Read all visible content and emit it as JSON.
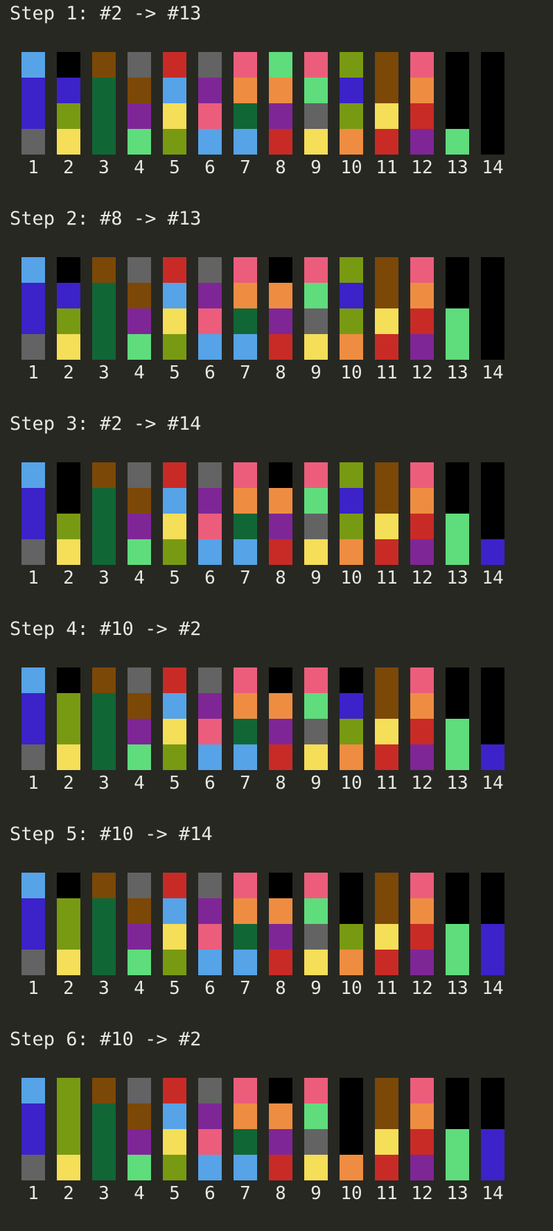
{
  "colors": {
    "background": "#272822",
    "text": "#e8e8e2",
    "empty": "#000000",
    "sky": "#56a3e8",
    "indigo": "#3c22c9",
    "gray": "#636363",
    "olive": "#789a12",
    "yellow": "#f5de58",
    "brown": "#7b4807",
    "dkgreen": "#116636",
    "purple": "#7f2697",
    "mint": "#5fdc7c",
    "red": "#c82b26",
    "pink": "#ec5d7c",
    "orange": "#ee8d41"
  },
  "steps": [
    {
      "title": "Step 1: #2 -> #13",
      "tubes": [
        {
          "label": "1",
          "balls": [
            "gray",
            "indigo",
            "indigo",
            "sky"
          ]
        },
        {
          "label": "2",
          "balls": [
            "yellow",
            "olive",
            "indigo"
          ]
        },
        {
          "label": "3",
          "balls": [
            "dkgreen",
            "dkgreen",
            "dkgreen",
            "brown"
          ]
        },
        {
          "label": "4",
          "balls": [
            "mint",
            "purple",
            "brown",
            "gray"
          ]
        },
        {
          "label": "5",
          "balls": [
            "olive",
            "yellow",
            "sky",
            "red"
          ]
        },
        {
          "label": "6",
          "balls": [
            "sky",
            "pink",
            "purple",
            "gray"
          ]
        },
        {
          "label": "7",
          "balls": [
            "sky",
            "dkgreen",
            "orange",
            "pink"
          ]
        },
        {
          "label": "8",
          "balls": [
            "red",
            "purple",
            "orange",
            "mint"
          ]
        },
        {
          "label": "9",
          "balls": [
            "yellow",
            "gray",
            "mint",
            "pink"
          ]
        },
        {
          "label": "10",
          "balls": [
            "orange",
            "olive",
            "indigo",
            "olive"
          ]
        },
        {
          "label": "11",
          "balls": [
            "red",
            "yellow",
            "brown",
            "brown"
          ]
        },
        {
          "label": "12",
          "balls": [
            "purple",
            "red",
            "orange",
            "pink"
          ]
        },
        {
          "label": "13",
          "balls": [
            "mint"
          ]
        },
        {
          "label": "14",
          "balls": []
        }
      ]
    },
    {
      "title": "Step 2: #8 -> #13",
      "tubes": [
        {
          "label": "1",
          "balls": [
            "gray",
            "indigo",
            "indigo",
            "sky"
          ]
        },
        {
          "label": "2",
          "balls": [
            "yellow",
            "olive",
            "indigo"
          ]
        },
        {
          "label": "3",
          "balls": [
            "dkgreen",
            "dkgreen",
            "dkgreen",
            "brown"
          ]
        },
        {
          "label": "4",
          "balls": [
            "mint",
            "purple",
            "brown",
            "gray"
          ]
        },
        {
          "label": "5",
          "balls": [
            "olive",
            "yellow",
            "sky",
            "red"
          ]
        },
        {
          "label": "6",
          "balls": [
            "sky",
            "pink",
            "purple",
            "gray"
          ]
        },
        {
          "label": "7",
          "balls": [
            "sky",
            "dkgreen",
            "orange",
            "pink"
          ]
        },
        {
          "label": "8",
          "balls": [
            "red",
            "purple",
            "orange"
          ]
        },
        {
          "label": "9",
          "balls": [
            "yellow",
            "gray",
            "mint",
            "pink"
          ]
        },
        {
          "label": "10",
          "balls": [
            "orange",
            "olive",
            "indigo",
            "olive"
          ]
        },
        {
          "label": "11",
          "balls": [
            "red",
            "yellow",
            "brown",
            "brown"
          ]
        },
        {
          "label": "12",
          "balls": [
            "purple",
            "red",
            "orange",
            "pink"
          ]
        },
        {
          "label": "13",
          "balls": [
            "mint",
            "mint"
          ]
        },
        {
          "label": "14",
          "balls": []
        }
      ]
    },
    {
      "title": "Step 3: #2 -> #14",
      "tubes": [
        {
          "label": "1",
          "balls": [
            "gray",
            "indigo",
            "indigo",
            "sky"
          ]
        },
        {
          "label": "2",
          "balls": [
            "yellow",
            "olive"
          ]
        },
        {
          "label": "3",
          "balls": [
            "dkgreen",
            "dkgreen",
            "dkgreen",
            "brown"
          ]
        },
        {
          "label": "4",
          "balls": [
            "mint",
            "purple",
            "brown",
            "gray"
          ]
        },
        {
          "label": "5",
          "balls": [
            "olive",
            "yellow",
            "sky",
            "red"
          ]
        },
        {
          "label": "6",
          "balls": [
            "sky",
            "pink",
            "purple",
            "gray"
          ]
        },
        {
          "label": "7",
          "balls": [
            "sky",
            "dkgreen",
            "orange",
            "pink"
          ]
        },
        {
          "label": "8",
          "balls": [
            "red",
            "purple",
            "orange"
          ]
        },
        {
          "label": "9",
          "balls": [
            "yellow",
            "gray",
            "mint",
            "pink"
          ]
        },
        {
          "label": "10",
          "balls": [
            "orange",
            "olive",
            "indigo",
            "olive"
          ]
        },
        {
          "label": "11",
          "balls": [
            "red",
            "yellow",
            "brown",
            "brown"
          ]
        },
        {
          "label": "12",
          "balls": [
            "purple",
            "red",
            "orange",
            "pink"
          ]
        },
        {
          "label": "13",
          "balls": [
            "mint",
            "mint"
          ]
        },
        {
          "label": "14",
          "balls": [
            "indigo"
          ]
        }
      ]
    },
    {
      "title": "Step 4: #10 -> #2",
      "tubes": [
        {
          "label": "1",
          "balls": [
            "gray",
            "indigo",
            "indigo",
            "sky"
          ]
        },
        {
          "label": "2",
          "balls": [
            "yellow",
            "olive",
            "olive"
          ]
        },
        {
          "label": "3",
          "balls": [
            "dkgreen",
            "dkgreen",
            "dkgreen",
            "brown"
          ]
        },
        {
          "label": "4",
          "balls": [
            "mint",
            "purple",
            "brown",
            "gray"
          ]
        },
        {
          "label": "5",
          "balls": [
            "olive",
            "yellow",
            "sky",
            "red"
          ]
        },
        {
          "label": "6",
          "balls": [
            "sky",
            "pink",
            "purple",
            "gray"
          ]
        },
        {
          "label": "7",
          "balls": [
            "sky",
            "dkgreen",
            "orange",
            "pink"
          ]
        },
        {
          "label": "8",
          "balls": [
            "red",
            "purple",
            "orange"
          ]
        },
        {
          "label": "9",
          "balls": [
            "yellow",
            "gray",
            "mint",
            "pink"
          ]
        },
        {
          "label": "10",
          "balls": [
            "orange",
            "olive",
            "indigo"
          ]
        },
        {
          "label": "11",
          "balls": [
            "red",
            "yellow",
            "brown",
            "brown"
          ]
        },
        {
          "label": "12",
          "balls": [
            "purple",
            "red",
            "orange",
            "pink"
          ]
        },
        {
          "label": "13",
          "balls": [
            "mint",
            "mint"
          ]
        },
        {
          "label": "14",
          "balls": [
            "indigo"
          ]
        }
      ]
    },
    {
      "title": "Step 5: #10 -> #14",
      "tubes": [
        {
          "label": "1",
          "balls": [
            "gray",
            "indigo",
            "indigo",
            "sky"
          ]
        },
        {
          "label": "2",
          "balls": [
            "yellow",
            "olive",
            "olive"
          ]
        },
        {
          "label": "3",
          "balls": [
            "dkgreen",
            "dkgreen",
            "dkgreen",
            "brown"
          ]
        },
        {
          "label": "4",
          "balls": [
            "mint",
            "purple",
            "brown",
            "gray"
          ]
        },
        {
          "label": "5",
          "balls": [
            "olive",
            "yellow",
            "sky",
            "red"
          ]
        },
        {
          "label": "6",
          "balls": [
            "sky",
            "pink",
            "purple",
            "gray"
          ]
        },
        {
          "label": "7",
          "balls": [
            "sky",
            "dkgreen",
            "orange",
            "pink"
          ]
        },
        {
          "label": "8",
          "balls": [
            "red",
            "purple",
            "orange"
          ]
        },
        {
          "label": "9",
          "balls": [
            "yellow",
            "gray",
            "mint",
            "pink"
          ]
        },
        {
          "label": "10",
          "balls": [
            "orange",
            "olive"
          ]
        },
        {
          "label": "11",
          "balls": [
            "red",
            "yellow",
            "brown",
            "brown"
          ]
        },
        {
          "label": "12",
          "balls": [
            "purple",
            "red",
            "orange",
            "pink"
          ]
        },
        {
          "label": "13",
          "balls": [
            "mint",
            "mint"
          ]
        },
        {
          "label": "14",
          "balls": [
            "indigo",
            "indigo"
          ]
        }
      ]
    },
    {
      "title": "Step 6: #10 -> #2",
      "tubes": [
        {
          "label": "1",
          "balls": [
            "gray",
            "indigo",
            "indigo",
            "sky"
          ]
        },
        {
          "label": "2",
          "balls": [
            "yellow",
            "olive",
            "olive",
            "olive"
          ]
        },
        {
          "label": "3",
          "balls": [
            "dkgreen",
            "dkgreen",
            "dkgreen",
            "brown"
          ]
        },
        {
          "label": "4",
          "balls": [
            "mint",
            "purple",
            "brown",
            "gray"
          ]
        },
        {
          "label": "5",
          "balls": [
            "olive",
            "yellow",
            "sky",
            "red"
          ]
        },
        {
          "label": "6",
          "balls": [
            "sky",
            "pink",
            "purple",
            "gray"
          ]
        },
        {
          "label": "7",
          "balls": [
            "sky",
            "dkgreen",
            "orange",
            "pink"
          ]
        },
        {
          "label": "8",
          "balls": [
            "red",
            "purple",
            "orange"
          ]
        },
        {
          "label": "9",
          "balls": [
            "yellow",
            "gray",
            "mint",
            "pink"
          ]
        },
        {
          "label": "10",
          "balls": [
            "orange"
          ]
        },
        {
          "label": "11",
          "balls": [
            "red",
            "yellow",
            "brown",
            "brown"
          ]
        },
        {
          "label": "12",
          "balls": [
            "purple",
            "red",
            "orange",
            "pink"
          ]
        },
        {
          "label": "13",
          "balls": [
            "mint",
            "mint"
          ]
        },
        {
          "label": "14",
          "balls": [
            "indigo",
            "indigo"
          ]
        }
      ]
    }
  ]
}
